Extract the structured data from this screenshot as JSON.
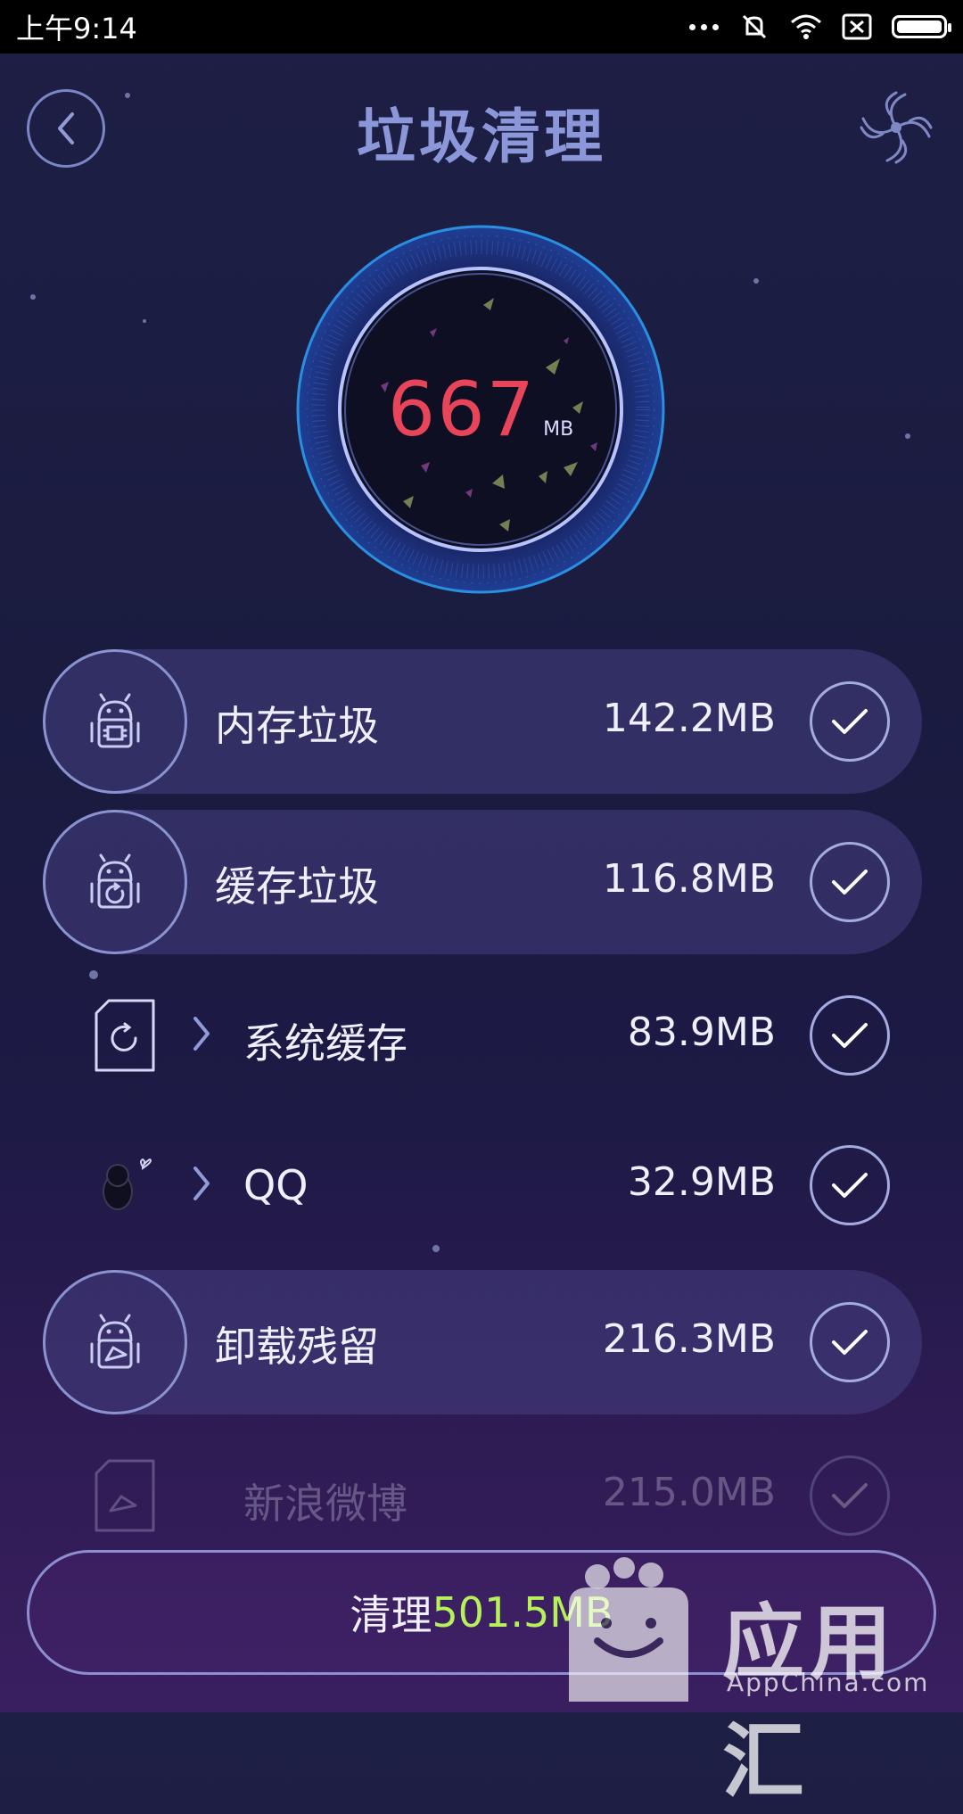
{
  "status_bar": {
    "time": "上午9:14"
  },
  "header": {
    "title": "垃圾清理"
  },
  "gauge": {
    "value": "667",
    "unit": "MB"
  },
  "rows": [
    {
      "label": "内存垃圾",
      "value": "142.2MB",
      "icon": "android-chip-icon",
      "checked": true
    },
    {
      "label": "缓存垃圾",
      "value": "116.8MB",
      "icon": "android-refresh-icon",
      "checked": true
    },
    {
      "label": "系统缓存",
      "value": "83.9MB",
      "icon": "file-refresh-icon",
      "checked": true
    },
    {
      "label": "QQ",
      "value": "32.9MB",
      "icon": "qq-penguin-icon",
      "checked": true
    },
    {
      "label": "卸载残留",
      "value": "216.3MB",
      "icon": "android-package-icon",
      "checked": true
    },
    {
      "label": "新浪微博",
      "value": "215.0MB",
      "icon": "file-icon",
      "checked": true
    }
  ],
  "clean_button": {
    "label": "清理",
    "amount": "501.5MB"
  },
  "watermark": {
    "title": "应用汇",
    "subtitle": "AppChina.com"
  },
  "colors": {
    "accent_red": "#e8455b",
    "accent_green": "#b6f05a",
    "title_blue": "#8b97d8"
  }
}
